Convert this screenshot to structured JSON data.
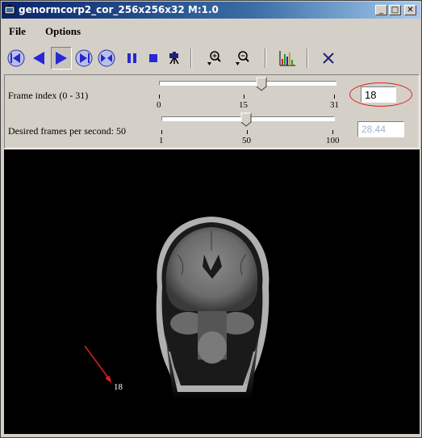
{
  "window": {
    "title": "genormcorp2_cor_256x256x32   M:1.0",
    "controls": [
      "_",
      "□",
      "✕"
    ]
  },
  "menu": {
    "items": [
      "File",
      "Options"
    ]
  },
  "toolbar": {
    "buttons": [
      "first-frame",
      "step-back",
      "play-forward",
      "play-loop",
      "play-bounce",
      "pause",
      "stop",
      "record",
      "zoom-in",
      "zoom-out",
      "histogram",
      "close"
    ],
    "pressed": "play-forward"
  },
  "frame_slider": {
    "label": "Frame index (0 - 31)",
    "min": 0,
    "max": 31,
    "value": 18,
    "tick_labels": [
      "0",
      "15",
      "31"
    ],
    "field_value": "18"
  },
  "fps_slider": {
    "label": "Desired frames per second: 50",
    "min": 1,
    "max": 100,
    "value": 50,
    "tick_labels": [
      "1",
      "50",
      "100"
    ],
    "actual_fps": "28.44"
  },
  "viewer": {
    "frame_number": "18"
  },
  "colors": {
    "annotation": "#e02020",
    "title_start": "#0a246a",
    "title_end": "#a6caf0"
  }
}
